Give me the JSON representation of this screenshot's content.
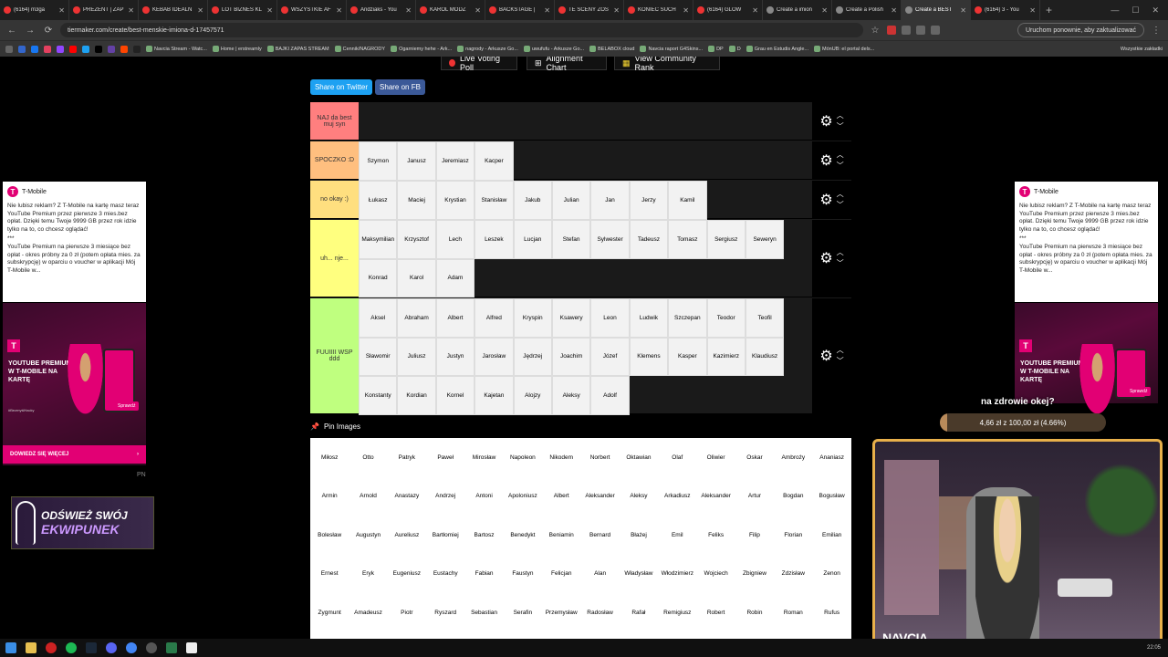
{
  "browser": {
    "tabs": [
      {
        "title": "(6164) m3ga",
        "icon": "youtube-icon",
        "active": false
      },
      {
        "title": "PREZENT | ZAP",
        "icon": "youtube-icon",
        "active": false
      },
      {
        "title": "KEBAB IDEALN",
        "icon": "youtube-icon",
        "active": false
      },
      {
        "title": "LOT BIZNES KL",
        "icon": "youtube-icon",
        "active": false
      },
      {
        "title": "WSZYSTKIE AF",
        "icon": "youtube-icon",
        "active": false
      },
      {
        "title": "Andziaks - You",
        "icon": "youtube-icon",
        "active": false
      },
      {
        "title": "KAROL MODZ",
        "icon": "youtube-icon",
        "active": false
      },
      {
        "title": "BACKSTAGE | ",
        "icon": "youtube-icon",
        "active": false
      },
      {
        "title": "TE SCENY ZOS",
        "icon": "youtube-icon",
        "active": false
      },
      {
        "title": "KONIEC SUCH",
        "icon": "youtube-icon",
        "active": false
      },
      {
        "title": "(6164) GLOW",
        "icon": "youtube-icon",
        "active": false
      },
      {
        "title": "Create a imion",
        "icon": "tiermaker-icon",
        "active": false
      },
      {
        "title": "Create a Polish",
        "icon": "tiermaker-icon",
        "active": false
      },
      {
        "title": "Create a BEST",
        "icon": "tiermaker-icon",
        "active": true
      },
      {
        "title": "(6164) 3 - You",
        "icon": "youtube-icon",
        "active": false
      }
    ],
    "new_tab": "+",
    "url": "tiermaker.com/create/best-menskie-imiona-d-17457571",
    "restart_label": "Uruchom ponownie, aby zaktualizować",
    "bookmarks": [
      "Navcia Stream - Watc...",
      "Home | erstreamly",
      "BAJKI ZAPAS STREAM",
      "Cennik/NAGRODY",
      "Ogarniemy hehe - Ark...",
      "nagrody - Arkusze Go...",
      "uwufufu - Arkusze Go...",
      "BELABOX cloud",
      "Navcia raport G4Skins...",
      "DP",
      "D",
      "Grau en Estudis Angle...",
      "MónUB: el portal dels..."
    ],
    "all_bookmarks": "Wszystkie zakładki",
    "badge": "9784"
  },
  "toolbar": {
    "live_voting": "Live Voting Poll",
    "alignment_chart": "Alignment Chart",
    "community_rank": "View Community Rank",
    "share_twitter": "Share on Twitter",
    "share_fb": "Share on FB"
  },
  "tiers": [
    {
      "label": "NAJ da best muj syn",
      "color": "#ff7f7f",
      "height": 42,
      "items": []
    },
    {
      "label": "SPOCZKO :D",
      "color": "#ffbf7f",
      "height": 42,
      "items": [
        "Szymon",
        "Janusz",
        "Jeremiasz",
        "Kacper"
      ]
    },
    {
      "label": "no okay :)",
      "color": "#ffdf7f",
      "height": 42,
      "items": [
        "Łukasz",
        "Maciej",
        "Krystian",
        "Stanisław",
        "Jakub",
        "Julian",
        "Jan",
        "Jerzy",
        "Kamil"
      ]
    },
    {
      "label": "uh... nje...",
      "color": "#ffff7f",
      "height": 85,
      "items": [
        "Maksymilian",
        "Krzysztof",
        "Lech",
        "Leszek",
        "Lucjan",
        "Stefan",
        "Sylwester",
        "Tadeusz",
        "Tomasz",
        "Sergiusz",
        "Seweryn",
        "Konrad",
        "Karol",
        "Adam"
      ]
    },
    {
      "label": "FUUIIII WSP ddd",
      "color": "#bfff7f",
      "height": 127,
      "items": [
        "Aksel",
        "Abraham",
        "Albert",
        "Alfred",
        "Kryspin",
        "Ksawery",
        "Leon",
        "Ludwik",
        "Szczepan",
        "Teodor",
        "Teofil",
        "Sławomir",
        "Juliusz",
        "Justyn",
        "Jarosław",
        "Jędrzej",
        "Joachim",
        "Józef",
        "Klemens",
        "Kasper",
        "Kazimierz",
        "Klaudiusz",
        "Konstanty",
        "Kordian",
        "Kornel",
        "Kajetan",
        "Alojzy",
        "Aleksy",
        "Adolf"
      ]
    }
  ],
  "pin_images": "Pin Images",
  "pool": [
    "Miłosz",
    "Otto",
    "Patryk",
    "Paweł",
    "Mirosław",
    "Napoleon",
    "Nikodem",
    "Norbert",
    "Oktawian",
    "Olaf",
    "Oliwier",
    "Oskar",
    "Ambroży",
    "Ananiasz",
    "Armin",
    "Arnold",
    "Anastazy",
    "Andrzej",
    "Antoni",
    "Apoloniusz",
    "Albert",
    "Aleksander",
    "Aleksy",
    "Arkadiusz",
    "Aleksander",
    "Artur",
    "Bogdan",
    "Bogusław",
    "Bolesław",
    "Augustyn",
    "Aureliusz",
    "Bartłomiej",
    "Bartosz",
    "Benedykt",
    "Beniamin",
    "Bernard",
    "Błażej",
    "Emil",
    "Feliks",
    "Filip",
    "Florian",
    "Emilian",
    "Ernest",
    "Eryk",
    "Eugeniusz",
    "Eustachy",
    "Fabian",
    "Faustyn",
    "Felicjan",
    "Alan",
    "Władysław",
    "Włodzimierz",
    "Wojciech",
    "Zbigniew",
    "Zdzisław",
    "Zenon",
    "Zygmunt",
    "Amadeusz",
    "Piotr",
    "Ryszard",
    "Sebastian",
    "Serafin",
    "Przemysław",
    "Radosław",
    "Rafał",
    "Remigiusz",
    "Robert",
    "Robin",
    "Roman",
    "Rufus"
  ],
  "ad": {
    "brand": "T-Mobile",
    "text": "Nie lubisz reklam? Z T-Mobile na kartę masz teraz YouTube Premium przez pierwsze 3 mies.bez opłat. Dzięki temu Twoje 9999 GB przez rok idzie tylko na to, co chcesz oglądać!",
    "sep": "***",
    "text2": "YouTube Premium na pierwsze 3 miesiące bez opłat - okres próbny za 0 zł (potem opłata mies. za subskrypcję) w oparciu o voucher w aplikacji Mój T-Mobile w...",
    "image_title": "YOUTUBE PREMIUM W T-MOBILE NA KARTĘ",
    "image_tag": "#BezmyślHacky",
    "image_button": "Sprawdź",
    "cta": "DOWIEDZ SIĘ WIĘCEJ",
    "cta_arrow": "›",
    "pn": "PN"
  },
  "overlay": {
    "ekwipunek_line1": "ODŚWIEŻ SWÓJ",
    "ekwipunek_line2": "EKWIPUNEK",
    "goal_title": "na zdrowie okej?",
    "goal_text": "4,66 zł z 100,00 zł (4.66%)",
    "goal_progress": 0.0466,
    "cam_name": "NAVCIA"
  },
  "taskbar": {
    "clock": "22:05"
  }
}
